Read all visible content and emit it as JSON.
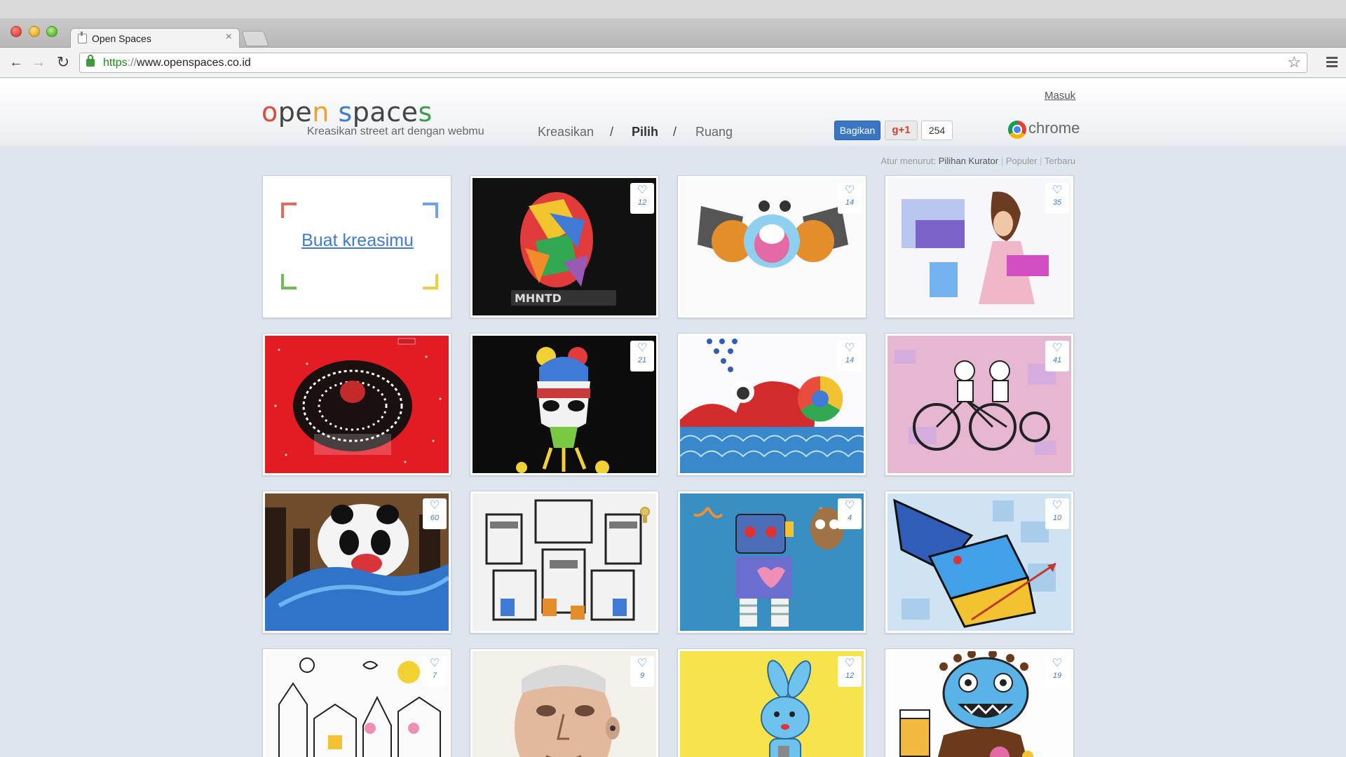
{
  "browser": {
    "tab_title": "Open Spaces",
    "tab_close": "×",
    "url_scheme": "https",
    "url_sep": "://",
    "url_rest": "www.openspaces.co.id",
    "back_glyph": "←",
    "forward_glyph": "→",
    "reload_glyph": "↻",
    "star_glyph": "☆"
  },
  "header": {
    "login": "Masuk",
    "logo": {
      "p1": "o",
      "p2": "p",
      "p3": "e",
      "p4": "n",
      "p5": " ",
      "p6": "s",
      "p7": "p",
      "p8": "a",
      "p9": "c",
      "p10": "e",
      "p11": "s"
    },
    "tagline": "Kreasikan street art dengan webmu",
    "nav": {
      "kreasikan": "Kreasikan",
      "slash": "/",
      "pilih": "Pilih",
      "ruang": "Ruang"
    },
    "share": "Bagikan",
    "gplus": "+1",
    "gplus_count": "254",
    "chrome": "chrome"
  },
  "sort": {
    "label": "Atur menurut:",
    "options": [
      "Pilihan Kurator",
      "Populer",
      "Terbaru"
    ],
    "separator": "|"
  },
  "grid": {
    "create_label": "Buat kreasimu",
    "heart_glyph": "♡",
    "likes": [
      "12",
      "14",
      "35",
      "",
      "21",
      "14",
      "41",
      "60",
      "",
      "4",
      "10",
      "7",
      "9",
      "12",
      "19"
    ]
  },
  "colors": {
    "brand_blue": "#3f7ad6",
    "logo_red": "#dd4b39",
    "logo_orange": "#f4a11c",
    "logo_blue": "#3f7ad6",
    "logo_green": "#3a9d4a"
  }
}
